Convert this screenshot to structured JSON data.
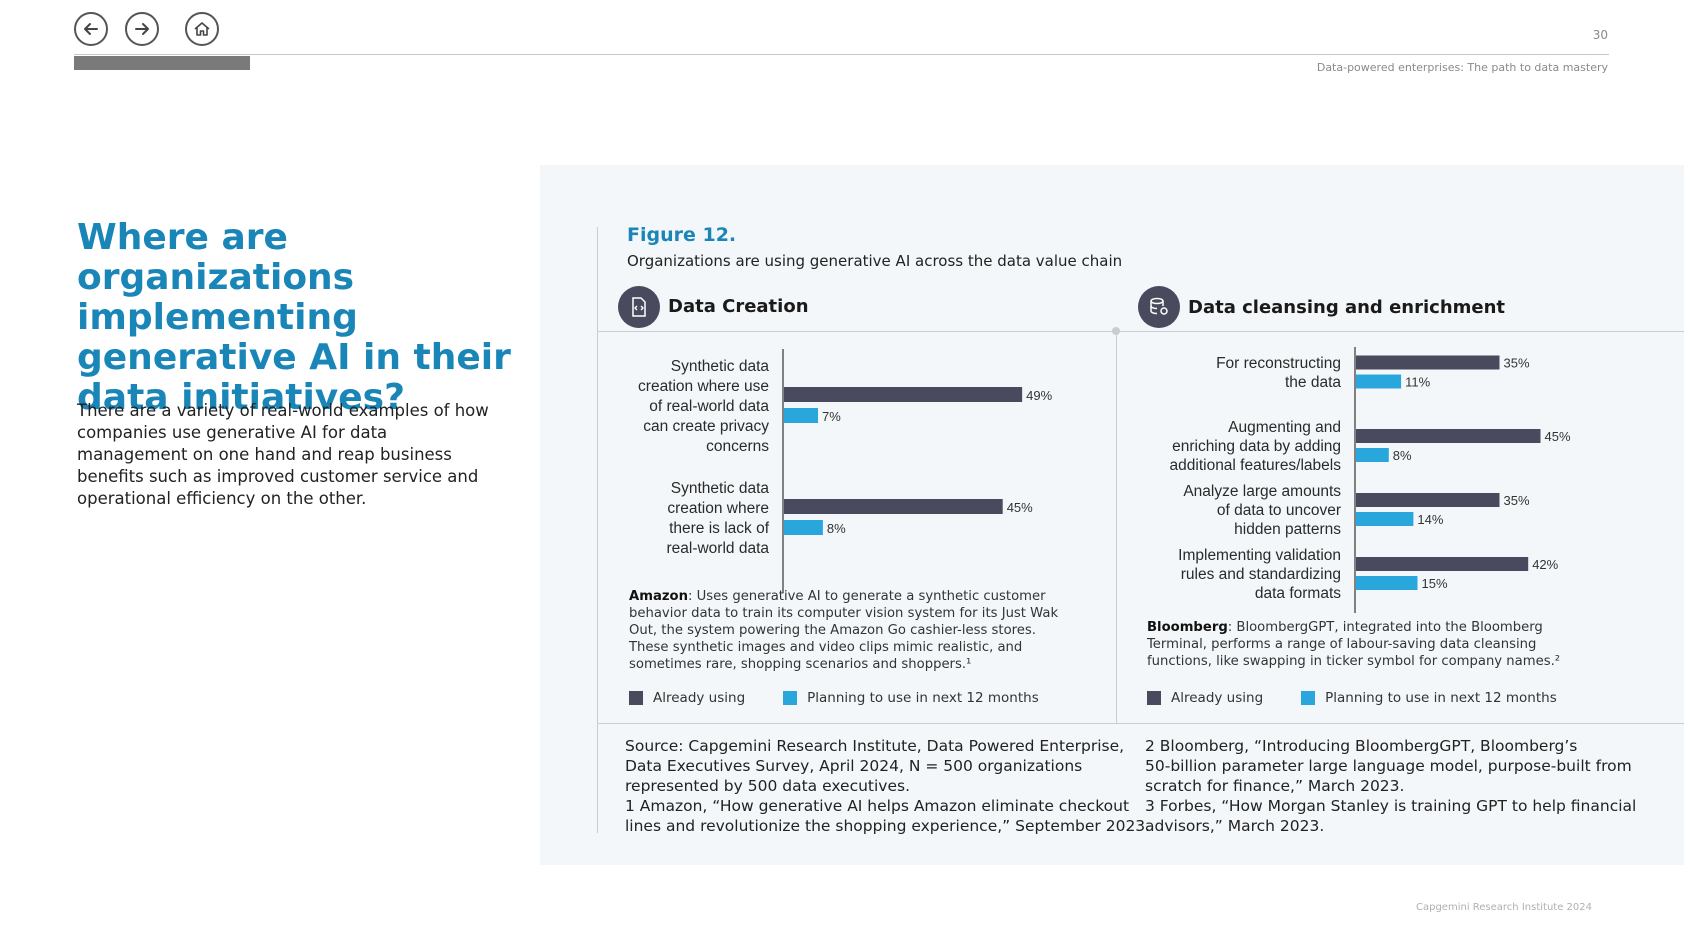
{
  "header": {
    "page_number": "30",
    "doc_title": "Data-powered enterprises: The path to data mastery",
    "nav": [
      "back",
      "forward",
      "home"
    ]
  },
  "left": {
    "heading": "Where are organizations implementing generative AI in their data initiatives?",
    "intro": "There are a variety of real-world examples of how companies use generative AI for data management on one hand and reap business benefits such as improved customer service and operational efficiency on the other."
  },
  "figure": {
    "label": "Figure 12.",
    "subtitle": "Organizations are using generative AI across the data value chain"
  },
  "colors": {
    "already_using": "#4a4a5e",
    "planning": "#29a7dd",
    "heading_blue": "#1a86b8"
  },
  "chart_data": [
    {
      "type": "bar",
      "orientation": "horizontal",
      "title": "Data Creation",
      "categories": [
        [
          "Synthetic data",
          "creation where use",
          "of real-world data",
          "can create privacy",
          "concerns"
        ],
        [
          "Synthetic data",
          "creation where",
          "there is lack of",
          "real-world data"
        ]
      ],
      "series": [
        {
          "name": "Already using",
          "values": [
            49,
            45
          ],
          "labels": [
            "49%",
            "45%"
          ]
        },
        {
          "name": "Planning to use in next 12 months",
          "values": [
            7,
            8
          ],
          "labels": [
            "7%",
            "8%"
          ]
        }
      ],
      "xlim": [
        0,
        100
      ],
      "legend": "bottom",
      "grid": false
    },
    {
      "type": "bar",
      "orientation": "horizontal",
      "title": "Data cleansing and enrichment",
      "categories": [
        [
          "For reconstructing",
          "the data"
        ],
        [
          "Augmenting and",
          "enriching data by adding",
          "additional features/labels"
        ],
        [
          "Analyze large amounts",
          "of data to uncover",
          "hidden patterns"
        ],
        [
          "Implementing validation",
          "rules and standardizing",
          "data formats"
        ]
      ],
      "series": [
        {
          "name": "Already using",
          "values": [
            35,
            45,
            35,
            42
          ],
          "labels": [
            "35%",
            "45%",
            "35%",
            "42%"
          ]
        },
        {
          "name": "Planning to use in next 12 months",
          "values": [
            11,
            8,
            14,
            15
          ],
          "labels": [
            "11%",
            "8%",
            "14%",
            "15%"
          ]
        }
      ],
      "xlim": [
        0,
        100
      ],
      "legend": "bottom",
      "grid": false
    }
  ],
  "notes": {
    "amazon_bold": "Amazon",
    "amazon_lines": [
      ": Uses generative AI to generate a synthetic customer",
      "behavior data to train its computer vision system for its Just Wak",
      "Out, the system powering the Amazon Go cashier-less stores.",
      "These synthetic images and video clips mimic realistic, and",
      "sometimes rare, shopping scenarios and shoppers.¹"
    ],
    "bloomberg_bold": "Bloomberg",
    "bloomberg_lines": [
      ": BloombergGPT, integrated into the Bloomberg",
      "Terminal, performs a range of labour-saving data cleansing",
      "functions, like swapping in ticker symbol for company names.²"
    ]
  },
  "legend": {
    "already": "Already using",
    "planning": "Planning to use in next 12 months"
  },
  "sources": {
    "left": [
      "Source: Capgemini Research Institute, Data Powered Enterprise,",
      "Data Executives Survey, April 2024, N = 500 organizations",
      "represented by 500 data executives.",
      "1 Amazon, “How generative AI helps Amazon eliminate checkout",
      "lines and revolutionize the shopping experience,” September 2023."
    ],
    "right": [
      "2 Bloomberg, “Introducing BloombergGPT, Bloomberg’s",
      "50-billion parameter large language model, purpose-built from",
      "scratch for finance,” March 2023.",
      "3 Forbes, “How Morgan Stanley is training GPT to help financial",
      "advisors,” March 2023."
    ]
  },
  "footer": "Capgemini Research Institute 2024"
}
